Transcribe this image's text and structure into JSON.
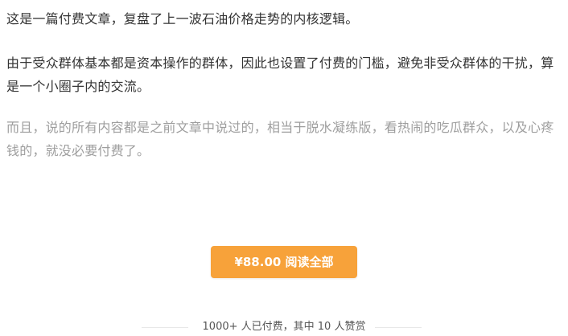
{
  "article": {
    "paragraphs": [
      "这是一篇付费文章，复盘了上一波石油价格走势的内核逻辑。",
      "由于受众群体基本都是资本操作的群体，因此也设置了付费的门槛，避免非受众群体的干扰，算是一个小圈子内的交流。",
      "而且，说的所有内容都是之前文章中说过的，相当于脱水凝练版，看热闹的吃瓜群众，以及心疼钱的，就没必要付费了。"
    ]
  },
  "paywall": {
    "button_label": "¥88.00 阅读全部",
    "button_color": "#f7a23a",
    "stats_text": "1000+ 人已付费，其中 10 人赞赏"
  }
}
